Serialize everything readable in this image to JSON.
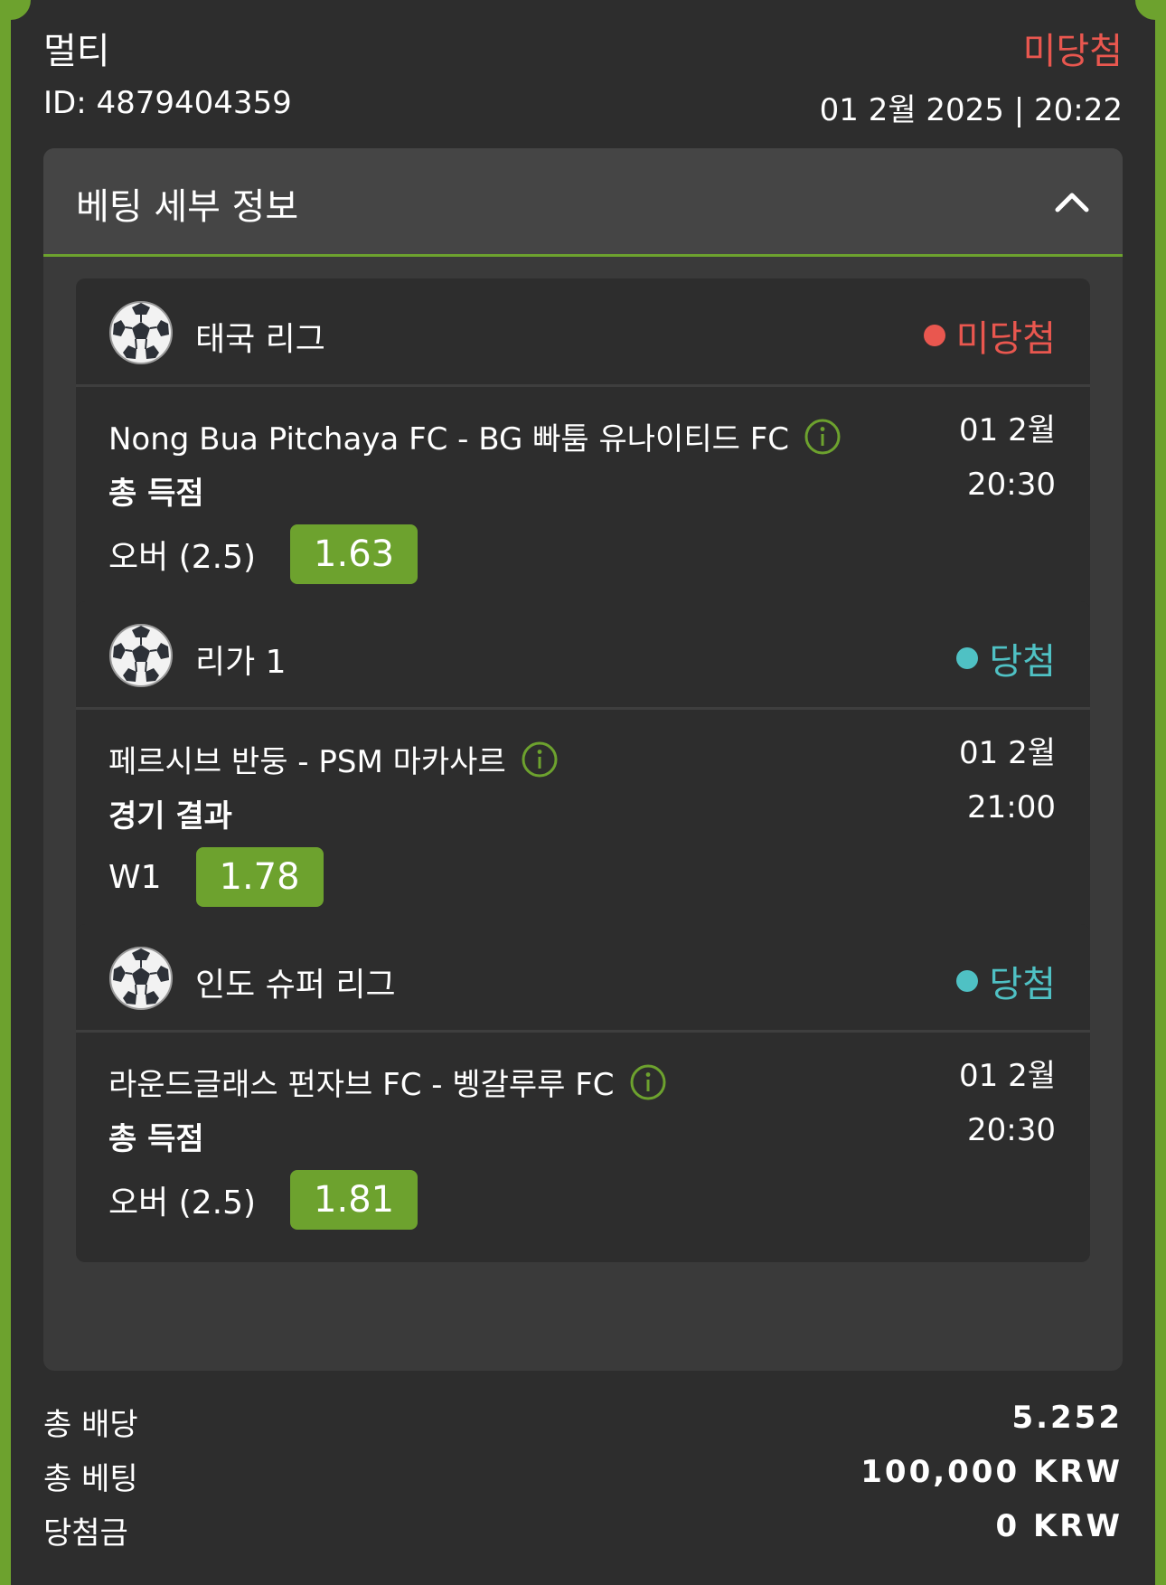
{
  "header": {
    "bet_type": "멀티",
    "status": "미당첨",
    "id_text": "ID: 4879404359",
    "datetime": "01 2월 2025 | 20:22"
  },
  "details": {
    "title": "베팅 세부 정보",
    "toggle_icon": "chevron-up-icon"
  },
  "bets": [
    {
      "league": "태국 리그",
      "status": "미당첨",
      "status_color": "#e9574f",
      "match": "Nong Bua Pitchaya FC - BG 빠툼 유나이티드 FC",
      "market": "총 득점",
      "date": "01 2월",
      "time": "20:30",
      "selection": "오버 (2.5)",
      "odds": "1.63"
    },
    {
      "league": "리가 1",
      "status": "당첨",
      "status_color": "#4fc1c4",
      "match": "페르시브 반둥 - PSM 마카사르",
      "market": "경기 결과",
      "date": "01 2월",
      "time": "21:00",
      "selection": "W1",
      "odds": "1.78"
    },
    {
      "league": "인도 슈퍼 리그",
      "status": "당첨",
      "status_color": "#4fc1c4",
      "match": "라운드글래스 펀자브 FC - 벵갈루루 FC",
      "market": "총 득점",
      "date": "01 2월",
      "time": "20:30",
      "selection": "오버 (2.5)",
      "odds": "1.81"
    }
  ],
  "totals": {
    "odds_label": "총 배당",
    "odds_value": "5.252",
    "stake_label": "총 베팅",
    "stake_value": "100,000 KRW",
    "payout_label": "당첨금",
    "payout_value": "0 KRW"
  },
  "colors": {
    "accent": "#6da22e",
    "lost": "#e9574f",
    "won": "#4fc1c4",
    "info_icon": "#6da22e"
  }
}
